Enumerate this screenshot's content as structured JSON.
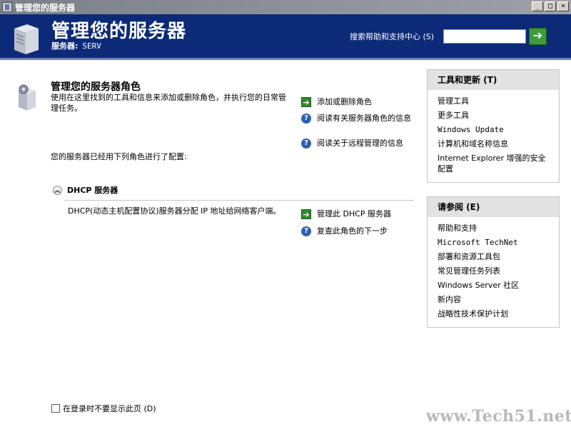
{
  "window": {
    "title": "管理您的服务器",
    "minimize": "_",
    "maximize": "□",
    "close": "×"
  },
  "header": {
    "heading": "管理您的服务器",
    "server_label": "服务器:",
    "server_name": "SERV",
    "search_label": "搜索帮助和支持中心 (S)",
    "search_value": "",
    "go_symbol": "➔"
  },
  "main": {
    "title": "管理您的服务器角色",
    "description": "使用在这里找到的工具和信息来添加或删除角色，并执行您的日常管理任务。",
    "actions": [
      {
        "icon": "arrow-icon",
        "label": "添加或删除角色"
      },
      {
        "icon": "help-icon",
        "label": "阅读有关服务器角色的信息"
      },
      {
        "icon": "help-icon",
        "label": "阅读关于远程管理的信息"
      }
    ],
    "configured_text": "您的服务器已经用下列角色进行了配置:",
    "role": {
      "name": "DHCP 服务器",
      "collapse_symbol": "︽",
      "description": "DHCP(动态主机配置协议)服务器分配 IP 地址给网络客户端。",
      "actions": [
        {
          "icon": "arrow-icon",
          "label": "管理此 DHCP 服务器"
        },
        {
          "icon": "help-icon",
          "label": "复查此角色的下一步"
        }
      ]
    },
    "dont_show_label": "在登录时不要显示此页 (D)"
  },
  "tools_panel": {
    "title": "工具和更新 (T)",
    "items": [
      "管理工具",
      "更多工具",
      "Windows Update",
      "计算机和域名称信息",
      "Internet Explorer 增强的安全配置"
    ]
  },
  "see_also_panel": {
    "title": "请参阅 (E)",
    "items": [
      "帮助和支持",
      "Microsoft TechNet",
      "部署和资源工具包",
      "常见管理任务列表",
      "Windows Server 社区",
      "新内容",
      "战略性技术保护计划"
    ]
  },
  "watermark": "www.Tech51.net",
  "icons": {
    "arrow": "➔",
    "help": "?"
  }
}
